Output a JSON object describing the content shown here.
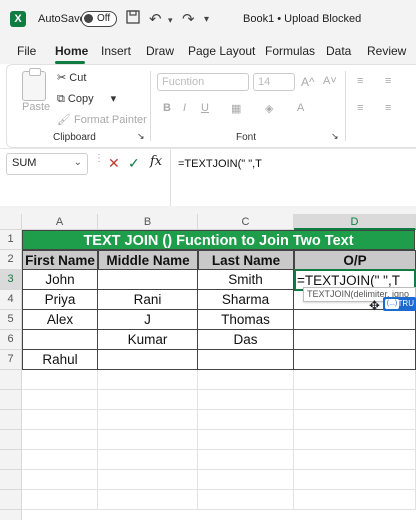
{
  "titlebar": {
    "app_logo": "X",
    "autosave_label": "AutoSave",
    "autosave_state": "Off",
    "doc_title": "Book1 • Upload Blocked",
    "icons": [
      "save-icon",
      "undo-icon",
      "redo-icon",
      "customize-icon"
    ]
  },
  "ribbon_tabs": [
    "File",
    "Home",
    "Insert",
    "Draw",
    "Page Layout",
    "Formulas",
    "Data",
    "Review"
  ],
  "active_tab": "Home",
  "clipboard": {
    "paste": "Paste",
    "cut": "Cut",
    "copy": "Copy",
    "format_painter": "Format Painter",
    "group_label": "Clipboard"
  },
  "font_group": {
    "font_name": "Fucntion",
    "font_size": "14",
    "group_label": "Font"
  },
  "formula_bar": {
    "name_box": "SUM",
    "cancel": "✕",
    "enter": "✓",
    "fx": "fx",
    "formula": "=TEXTJOIN(\" \",T"
  },
  "columns": [
    "A",
    "B",
    "C",
    "D"
  ],
  "rows": [
    "1",
    "2",
    "3",
    "4",
    "5",
    "6",
    "7"
  ],
  "sheet": {
    "title": "TEXT JOIN () Fucntion to Join Two Text",
    "headers": [
      "First Name",
      "Middle Name",
      "Last Name",
      "O/P"
    ],
    "data": [
      [
        "John",
        "",
        "Smith",
        "=TEXTJOIN(\" \",T"
      ],
      [
        "Priya",
        "Rani",
        "Sharma",
        ""
      ],
      [
        "Alex",
        "J",
        "Thomas",
        ""
      ],
      [
        "",
        "Kumar",
        "Das",
        ""
      ],
      [
        "Rahul",
        "",
        "",
        ""
      ]
    ]
  },
  "tooltip": "TEXTJOIN(delimiter, igno",
  "autocomplete": {
    "badge": "(...)",
    "text": "TRU"
  },
  "colors": {
    "accent": "#107c41",
    "title_fill": "#1e9e4a",
    "header_fill": "#c9c9c9"
  }
}
